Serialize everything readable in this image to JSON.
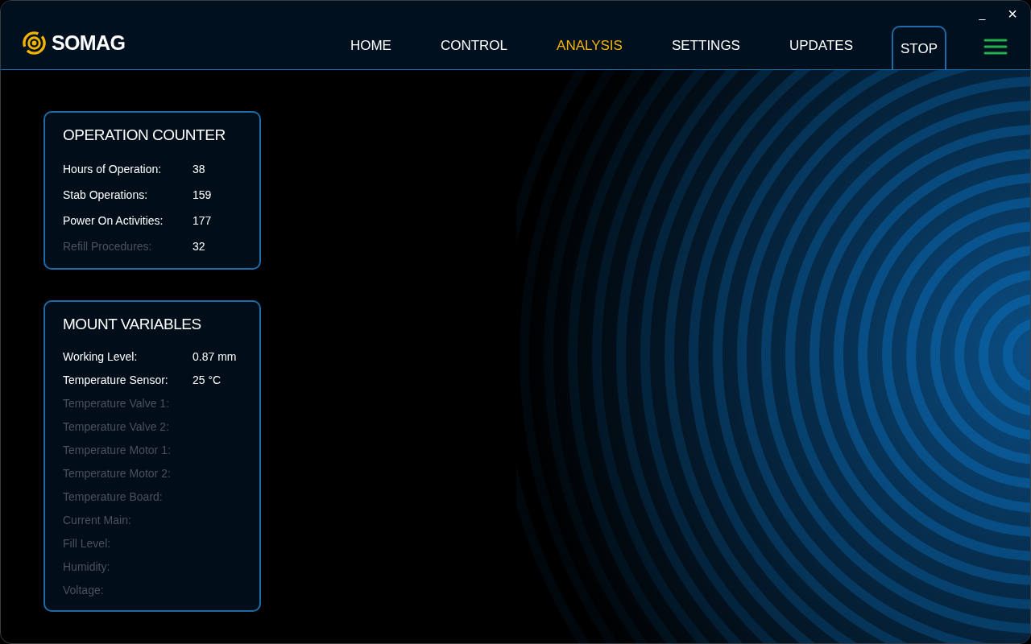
{
  "window": {
    "controls": [
      {
        "kind": "minimize",
        "label": "_"
      },
      {
        "kind": "close",
        "label": "×"
      }
    ]
  },
  "logo": {
    "text": "SOMAG"
  },
  "nav": [
    {
      "label": "HOME",
      "selected": false
    },
    {
      "label": "CONTROL",
      "selected": false
    },
    {
      "label": "ANALYSIS",
      "selected": true
    },
    {
      "label": "SETTINGS",
      "selected": false
    },
    {
      "label": "UPDATES",
      "selected": false
    }
  ],
  "stop_button": {
    "label": "STOP"
  },
  "cards": [
    {
      "title": "OPERATION COUNTER",
      "rows": [
        {
          "label": "Hours of Operation:",
          "value": "38",
          "disabled": false
        },
        {
          "label": "Stab Operations:",
          "value": "159",
          "disabled": false
        },
        {
          "label": "Power On Activities:",
          "value": "177",
          "disabled": false
        },
        {
          "label": "Refill Procedures:",
          "value": "32",
          "disabled": true
        }
      ]
    },
    {
      "title": "MOUNT VARIABLES",
      "rows": [
        {
          "label": "Working Level:",
          "value": "0.87 mm",
          "disabled": false
        },
        {
          "label": "Temperature Sensor:",
          "value": "25 °C",
          "disabled": false
        },
        {
          "label": "Temperature Valve 1:",
          "disabled": true
        },
        {
          "label": "Temperature Valve 2:",
          "disabled": true
        },
        {
          "label": "Temperature Motor 1:",
          "disabled": true
        },
        {
          "label": "Temperature Motor 2:",
          "disabled": true
        },
        {
          "label": "Temperature Board:",
          "disabled": true
        },
        {
          "label": "Current Main:",
          "disabled": true
        },
        {
          "label": "Fill Level:",
          "disabled": true
        },
        {
          "label": "Humidity:",
          "disabled": true
        },
        {
          "label": "Voltage:",
          "disabled": true
        }
      ]
    }
  ]
}
